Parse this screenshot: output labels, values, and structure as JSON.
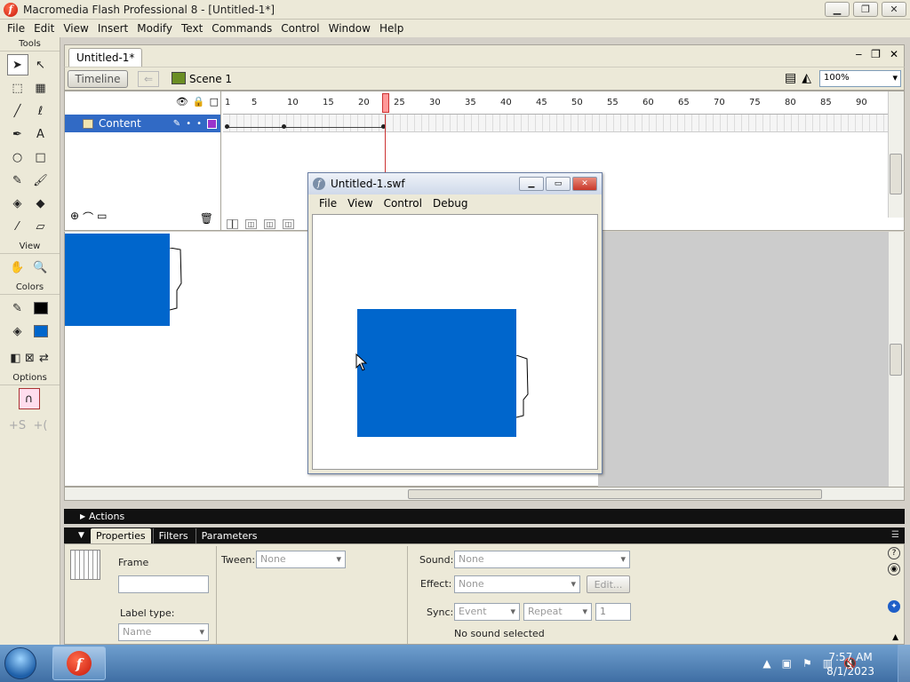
{
  "window": {
    "title": "Macromedia Flash Professional 8 - [Untitled-1*]",
    "min": "▁",
    "max": "❐",
    "close": "✕"
  },
  "menubar": [
    "File",
    "Edit",
    "View",
    "Insert",
    "Modify",
    "Text",
    "Commands",
    "Control",
    "Window",
    "Help"
  ],
  "tools": {
    "tools_label": "Tools",
    "view_label": "View",
    "colors_label": "Colors",
    "options_label": "Options"
  },
  "document": {
    "tab_label": "Untitled-1*",
    "timeline_label": "Timeline",
    "scene_label": "Scene 1",
    "zoom": "100%"
  },
  "timeline": {
    "layer_name": "Content",
    "frame_numbers": [
      "1",
      "5",
      "10",
      "15",
      "20",
      "25",
      "30",
      "35",
      "40",
      "45",
      "50",
      "55",
      "60",
      "65",
      "70",
      "75",
      "80",
      "85",
      "90"
    ],
    "current_frame": 23
  },
  "swf_window": {
    "title": "Untitled-1.swf",
    "menu": [
      "File",
      "View",
      "Control",
      "Debug"
    ]
  },
  "actions_panel": {
    "label": "Actions"
  },
  "properties": {
    "tabs": [
      "Properties",
      "Filters",
      "Parameters"
    ],
    "frame_label": "Frame",
    "frame_name_value": "",
    "label_type_label": "Label type:",
    "label_type_value": "Name",
    "tween_label": "Tween:",
    "tween_value": "None",
    "sound_label": "Sound:",
    "sound_value": "None",
    "effect_label": "Effect:",
    "effect_value": "None",
    "edit_button": "Edit...",
    "sync_label": "Sync:",
    "sync_value": "Event",
    "repeat_value": "Repeat",
    "repeat_count": "1",
    "sound_status": "No sound selected"
  },
  "taskbar": {
    "time": "7:57 AM",
    "date": "8/1/2023"
  },
  "colors": {
    "shape_blue": "#0066cc",
    "layer_selected": "#316ac5",
    "playhead": "#ff9999"
  }
}
